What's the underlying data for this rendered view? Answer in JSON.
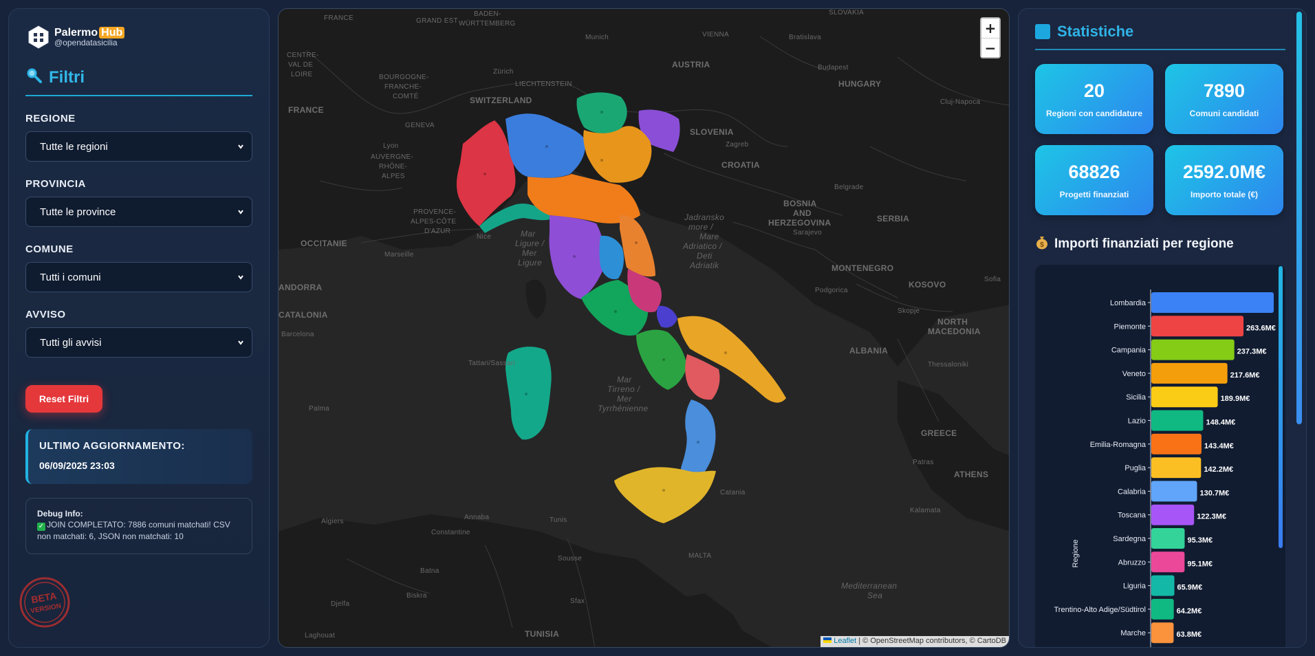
{
  "brand": {
    "name": "Palermo",
    "badge": "Hub",
    "handle": "@opendatasicilia"
  },
  "filters": {
    "title": "Filtri",
    "regione_label": "REGIONE",
    "regione_value": "Tutte le regioni",
    "provincia_label": "PROVINCIA",
    "provincia_value": "Tutte le province",
    "comune_label": "COMUNE",
    "comune_value": "Tutti i comuni",
    "avviso_label": "AVVISO",
    "avviso_value": "Tutti gli avvisi",
    "reset_label": "Reset Filtri"
  },
  "update": {
    "title": "ULTIMO AGGIORNAMENTO:",
    "date": "06/09/2025 23:03"
  },
  "debug": {
    "title": "Debug Info:",
    "message": "JOIN COMPLETATO: 7886 comuni matchati! CSV non matchati: 6, JSON non matchati: 10"
  },
  "beta": {
    "line1": "BETA",
    "line2": "VERSION"
  },
  "map": {
    "zoom_in": "+",
    "zoom_out": "−",
    "attribution_leaflet": "Leaflet",
    "attribution_rest": " | © OpenStreetMap contributors, © CartoDB",
    "labels": {
      "france_top": "FRANCE",
      "grand_est": "GRAND EST",
      "baden": "BADEN-",
      "wurttemberg": "WÜRTTEMBERG",
      "munich": "Munich",
      "vienna": "VIENNA",
      "bratislava": "Bratislava",
      "slovakia": "SLOVAKIA",
      "centre_1": "CENTRE-",
      "centre_2": "VAL DE",
      "centre_3": "LOIRE",
      "bourg_1": "BOURGOGNE-",
      "bourg_2": "FRANCHE-",
      "bourg_3": "COMTÉ",
      "zurich": "Zürich",
      "liechtenstein": "LIECHTENSTEIN",
      "switzerland": "SWITZERLAND",
      "austria": "AUSTRIA",
      "budapest": "Budapest",
      "hungary": "HUNGARY",
      "cluj": "Cluj-Napoca",
      "france": "FRANCE",
      "geneva": "GENEVA",
      "lyon": "Lyon",
      "auv_1": "AUVERGNE-",
      "auv_2": "RHÔNE-",
      "auv_3": "ALPES",
      "slovenia": "SLOVENIA",
      "zagreb": "Zagreb",
      "croatia": "CROATIA",
      "belgrade": "Belgrade",
      "bosnia_1": "BOSNIA",
      "bosnia_2": "AND",
      "bosnia_3": "HERZEGOVINA",
      "sarajevo": "Sarajevo",
      "serbia": "SERBIA",
      "provence_1": "PROVENCE-",
      "provence_2": "ALPES-CÔTE",
      "provence_3": "D'AZUR",
      "occitanie": "OCCITANIE",
      "marseille": "Marseille",
      "nice": "Nice",
      "mar_ligure_1": "Mar",
      "mar_ligure_2": "Ligure /",
      "mar_ligure_3": "Mer",
      "mar_ligure_4": "Ligure",
      "adriatic_1": "Jadransko",
      "adriatic_2": "more /",
      "adriatic_3": "Mare",
      "adriatic_4": "Adriatico /",
      "adriatic_5": "Deti",
      "adriatic_6": "Adriatik",
      "montenegro": "MONTENEGRO",
      "kosovo": "KOSOVO",
      "podgorica": "Podgorica",
      "sofia": "Sofia",
      "andorra": "ANDORRA",
      "catalonia": "CATALONIA",
      "barcelona": "Barcelona",
      "skopje": "Skopje",
      "north_1": "NORTH",
      "north_2": "MACEDONIA",
      "albania": "ALBANIA",
      "thessaloniki": "Thessaloniki",
      "tattari": "Tattari/Sassari",
      "tirreno_1": "Mar",
      "tirreno_2": "Tirreno /",
      "tirreno_3": "Mer",
      "tirreno_4": "Tyrrhénienne",
      "palma": "Palma",
      "greece": "GREECE",
      "athens": "ATHENS",
      "patras": "Patras",
      "kalamata": "Kalamata",
      "algiers": "Algiers",
      "annaba": "Annaba",
      "tunis": "Tunis",
      "constantine": "Constantine",
      "catania": "Catania",
      "sousse": "Sousse",
      "malta": "MALTA",
      "batna": "Batna",
      "biskra": "Biskra",
      "djelfa": "Djelfa",
      "sfax": "Sfax",
      "tunisia": "TUNISIA",
      "laghouat": "Laghouat",
      "med_1": "Mediterranean",
      "med_2": "Sea"
    }
  },
  "stats": {
    "title": "Statistiche",
    "cards": [
      {
        "value": "20",
        "label": "Regioni con candidature"
      },
      {
        "value": "7890",
        "label": "Comuni candidati"
      },
      {
        "value": "68826",
        "label": "Progetti finanziati"
      },
      {
        "value": "2592.0M€",
        "label": "Importo totale (€)"
      }
    ],
    "chart_title": "Importi finanziati per regione"
  },
  "chart_data": {
    "type": "bar",
    "orientation": "horizontal",
    "title": "Importi finanziati per regione",
    "ylabel": "Regione",
    "categories": [
      "Lombardia",
      "Piemonte",
      "Campania",
      "Veneto",
      "Sicilia",
      "Lazio",
      "Emilia-Romagna",
      "Puglia",
      "Calabria",
      "Toscana",
      "Sardegna",
      "Abruzzo",
      "Liguria",
      "Trentino-Alto Adige/Südtirol",
      "Marche"
    ],
    "values": [
      350,
      263.6,
      237.3,
      217.6,
      189.9,
      148.4,
      143.4,
      142.2,
      130.7,
      122.3,
      95.3,
      95.1,
      65.9,
      64.2,
      63.8
    ],
    "value_labels": [
      "",
      "263.6M€",
      "237.3M€",
      "217.6M€",
      "189.9M€",
      "148.4M€",
      "143.4M€",
      "142.2M€",
      "130.7M€",
      "122.3M€",
      "95.3M€",
      "95.1M€",
      "65.9M€",
      "64.2M€",
      "63.8M€"
    ],
    "colors": [
      "#3b82f6",
      "#ef4444",
      "#84cc16",
      "#f59e0b",
      "#facc15",
      "#10b981",
      "#f97316",
      "#fbbf24",
      "#60a5fa",
      "#a855f7",
      "#34d399",
      "#ec4899",
      "#14b8a6",
      "#10b981",
      "#fb923c"
    ],
    "unit": "M€"
  }
}
